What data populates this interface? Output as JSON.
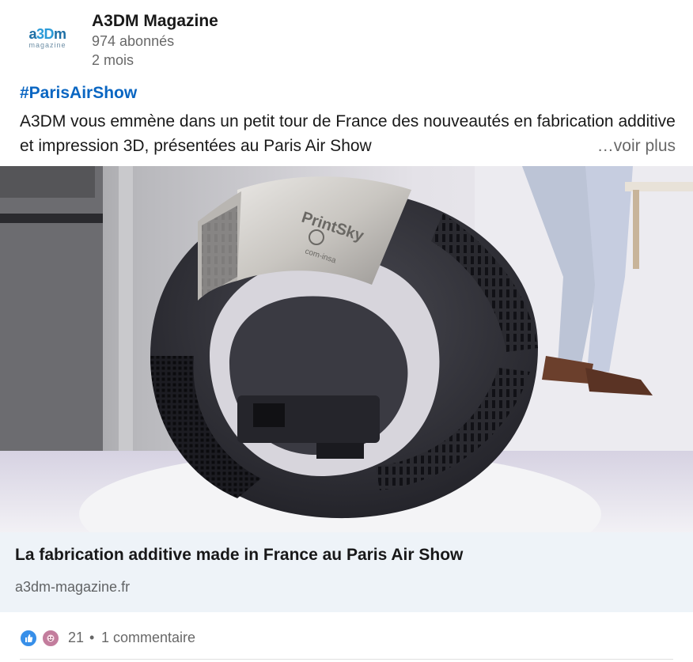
{
  "author": {
    "logo_text_a": "a",
    "logo_text_3d": "3D",
    "logo_text_m": "m",
    "logo_subtext": "magazine",
    "name": "A3DM Magazine",
    "followers": "974 abonnés",
    "time_ago": "2 mois"
  },
  "post": {
    "hashtag": "#ParisAirShow",
    "text": "A3DM vous emmène dans un petit tour de France des nouveautés en fabrication additive et impression 3D, présentées au Paris Air Show",
    "see_more": "…voir plus"
  },
  "media": {
    "engraved_text": "PrintSky",
    "engraved_subtext": "com-insa"
  },
  "link_card": {
    "title": "La fabrication additive made in France au Paris Air Show",
    "domain": "a3dm-magazine.fr"
  },
  "social": {
    "reaction_icons": [
      "like-icon",
      "insightful-icon"
    ],
    "reaction_count": "21",
    "separator": "•",
    "comments": "1 commentaire"
  },
  "colors": {
    "link_blue": "#0a66c2",
    "link_card_bg": "#eef3f8",
    "like_blue": "#378fe9"
  }
}
